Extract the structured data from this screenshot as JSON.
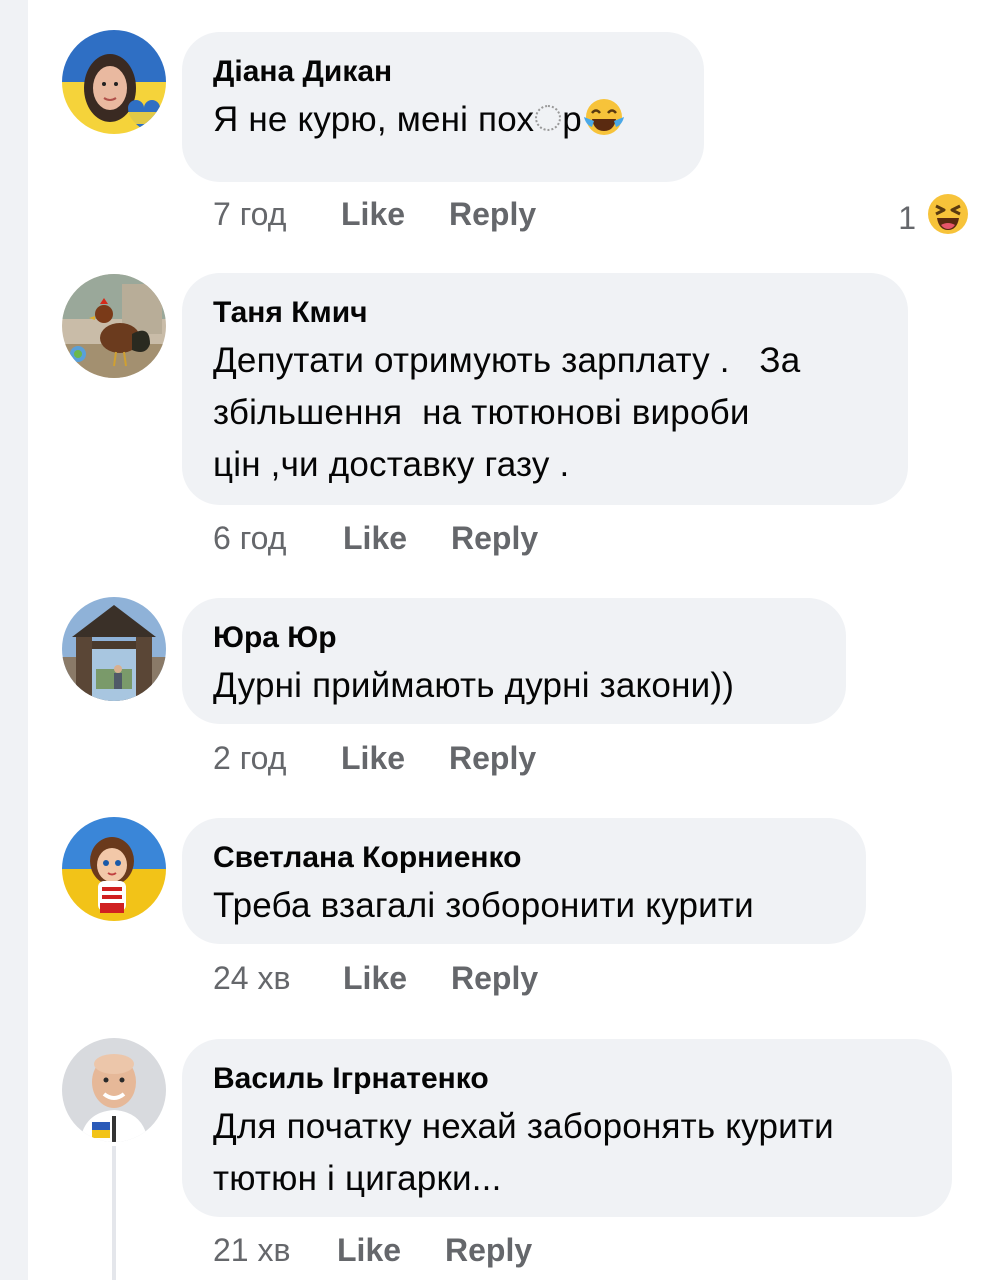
{
  "comments": [
    {
      "author": "Діана Дикан",
      "text": "Я не курю, мені пох",
      "text_tail": "р",
      "time": "7 год",
      "like": "Like",
      "reply": "Reply",
      "reaction_count": "1"
    },
    {
      "author": "Таня Кмич",
      "text_lines": [
        "Депутати отримують зарплату .   За",
        "збільшення  на тютюнові вироби",
        "цін ,чи доставку газу ."
      ],
      "time": "6 год",
      "like": "Like",
      "reply": "Reply"
    },
    {
      "author": "Юра Юр",
      "text": "Дурні приймають дурні закони))",
      "time": "2 год",
      "like": "Like",
      "reply": "Reply"
    },
    {
      "author": "Светлана Корниенко",
      "text": "Треба взагалі зоборонити курити",
      "time": "24 хв",
      "like": "Like",
      "reply": "Reply"
    },
    {
      "author": "Василь Ігрнатенко",
      "text_lines": [
        "Для початку нехай заборонять курити",
        "тютюн і цигарки..."
      ],
      "time": "21 хв",
      "like": "Like",
      "reply": "Reply"
    }
  ],
  "icons": {
    "laughing": "laughing-emoji-icon",
    "reaction": "haha-reaction-icon"
  },
  "colors": {
    "bubble": "#f0f2f5",
    "meta": "#65676b",
    "text": "#050505"
  }
}
